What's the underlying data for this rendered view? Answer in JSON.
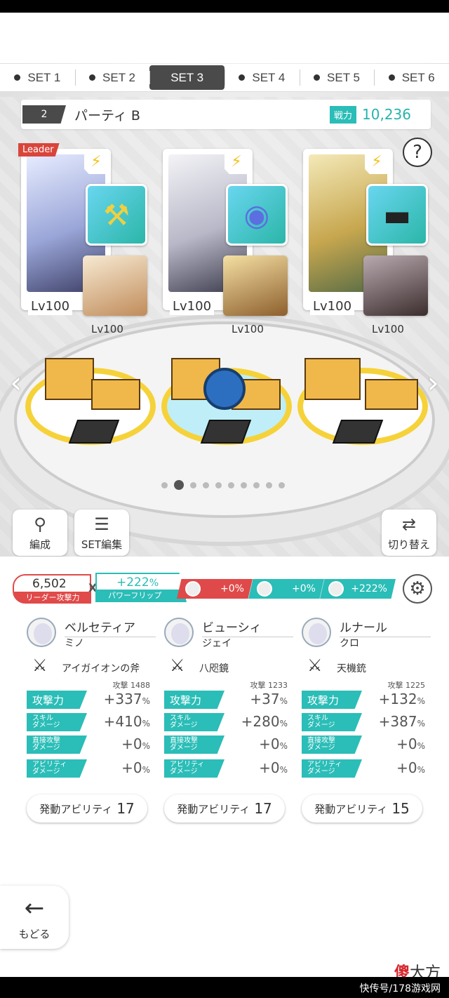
{
  "set_tabs": [
    "SET 1",
    "SET 2",
    "SET 3",
    "SET 4",
    "SET 5",
    "SET 6"
  ],
  "active_set": "SET 3",
  "party": {
    "number": "2",
    "name": "パーティ B",
    "power_label": "戦力",
    "power_value": "10,236"
  },
  "leader_badge": "Leader",
  "help_label": "?",
  "cards": [
    {
      "main_lv": "Lv100",
      "sub_lv": "Lv100",
      "bolt": "⚡"
    },
    {
      "main_lv": "Lv100",
      "sub_lv": "Lv100",
      "bolt": "⚡"
    },
    {
      "main_lv": "Lv100",
      "sub_lv": "Lv100",
      "bolt": "⚡"
    }
  ],
  "buttons": {
    "formation": "編成",
    "set_edit": "SET編集",
    "switch": "切り替え",
    "back": "もどる"
  },
  "leader_attack": {
    "value": "6,502",
    "label": "リーダー攻撃力"
  },
  "multiplier": "X",
  "power_flip": {
    "value": "+222",
    "unit": "%",
    "label": "パワーフリップ"
  },
  "bonus_pills": [
    {
      "value": "+0%",
      "color": "#e0494a"
    },
    {
      "value": "+0%",
      "color": "#2bbdb7"
    },
    {
      "value": "+222%",
      "color": "#2bbdb7"
    }
  ],
  "characters": [
    {
      "name": "ベルセティア",
      "sub": "ミノ",
      "weapon": "アイガイオンの斧",
      "base_attack": "攻撃 1488",
      "stats": [
        {
          "label": "攻撃力",
          "value": "+337",
          "unit": "%"
        },
        {
          "label1": "スキル",
          "label2": "ダメージ",
          "value": "+410",
          "unit": "%"
        },
        {
          "label1": "直接攻撃",
          "label2": "ダメージ",
          "value": "+0",
          "unit": "%"
        },
        {
          "label1": "アビリティ",
          "label2": "ダメージ",
          "value": "+0",
          "unit": "%"
        }
      ],
      "ability_label": "発動アビリティ",
      "ability_count": "17"
    },
    {
      "name": "ビューシィ",
      "sub": "ジェイ",
      "weapon": "八咫鏡",
      "base_attack": "攻撃 1233",
      "stats": [
        {
          "label": "攻撃力",
          "value": "+37",
          "unit": "%"
        },
        {
          "label1": "スキル",
          "label2": "ダメージ",
          "value": "+280",
          "unit": "%"
        },
        {
          "label1": "直接攻撃",
          "label2": "ダメージ",
          "value": "+0",
          "unit": "%"
        },
        {
          "label1": "アビリティ",
          "label2": "ダメージ",
          "value": "+0",
          "unit": "%"
        }
      ],
      "ability_label": "発動アビリティ",
      "ability_count": "17"
    },
    {
      "name": "ルナール",
      "sub": "クロ",
      "weapon": "天機銃",
      "base_attack": "攻撃 1225",
      "stats": [
        {
          "label": "攻撃力",
          "value": "+132",
          "unit": "%"
        },
        {
          "label1": "スキル",
          "label2": "ダメージ",
          "value": "+387",
          "unit": "%"
        },
        {
          "label1": "直接攻撃",
          "label2": "ダメージ",
          "value": "+0",
          "unit": "%"
        },
        {
          "label1": "アビリティ",
          "label2": "ダメージ",
          "value": "+0",
          "unit": "%"
        }
      ],
      "ability_label": "発動アビリティ",
      "ability_count": "15"
    }
  ],
  "watermark": {
    "red": "傻",
    "rest": "大方"
  },
  "footer": "快传号/178游戏网",
  "colors": {
    "teal": "#2bbdb7",
    "red": "#e04a4a",
    "yellow": "#f6d23a"
  }
}
